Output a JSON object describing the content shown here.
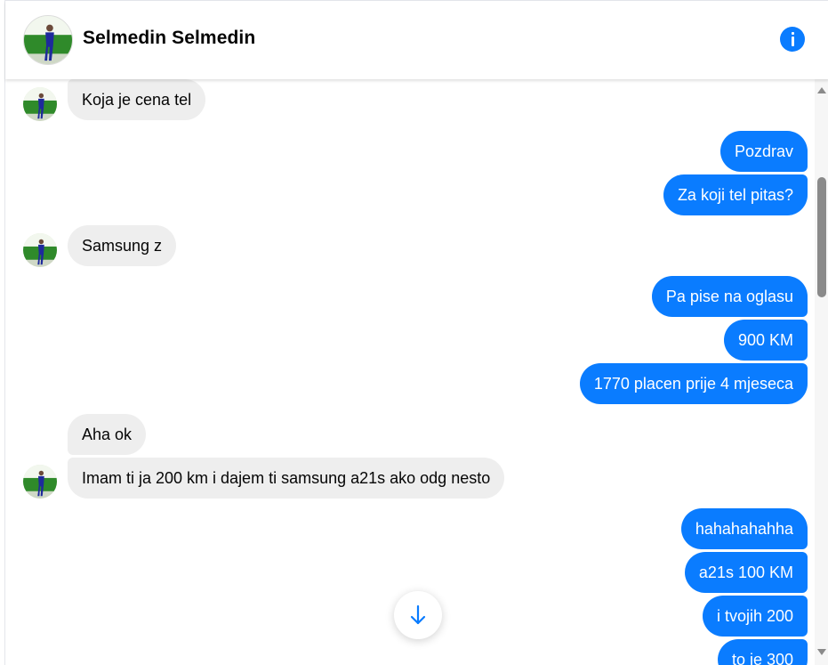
{
  "header": {
    "contact_name": "Selmedin Selmedin",
    "avatar_icon": "person-photo-avatar",
    "info_icon": "info-icon"
  },
  "colors": {
    "outgoing_bubble": "#0a7cff",
    "incoming_bubble": "#eeeeee",
    "accent": "#0a7cff"
  },
  "messages": [
    {
      "side": "in",
      "text": "Koja je cena tel"
    },
    {
      "side": "out",
      "text": "Pozdrav"
    },
    {
      "side": "out",
      "text": "Za koji tel pitas?"
    },
    {
      "side": "in",
      "text": "Samsung z"
    },
    {
      "side": "out",
      "text": "Pa pise na oglasu"
    },
    {
      "side": "out",
      "text": "900 KM"
    },
    {
      "side": "out",
      "text": "1770 placen prije 4 mjeseca"
    },
    {
      "side": "in",
      "text": "Aha ok"
    },
    {
      "side": "in",
      "text": "Imam ti ja 200 km i dajem ti samsung a21s  ako odg nesto"
    },
    {
      "side": "out",
      "text": "hahahahahha"
    },
    {
      "side": "out",
      "text": "a21s 100 KM"
    },
    {
      "side": "out",
      "text": "i tvojih 200"
    },
    {
      "side": "out",
      "text": "to je 300"
    }
  ],
  "scroll_to_bottom_icon": "arrow-down-icon"
}
